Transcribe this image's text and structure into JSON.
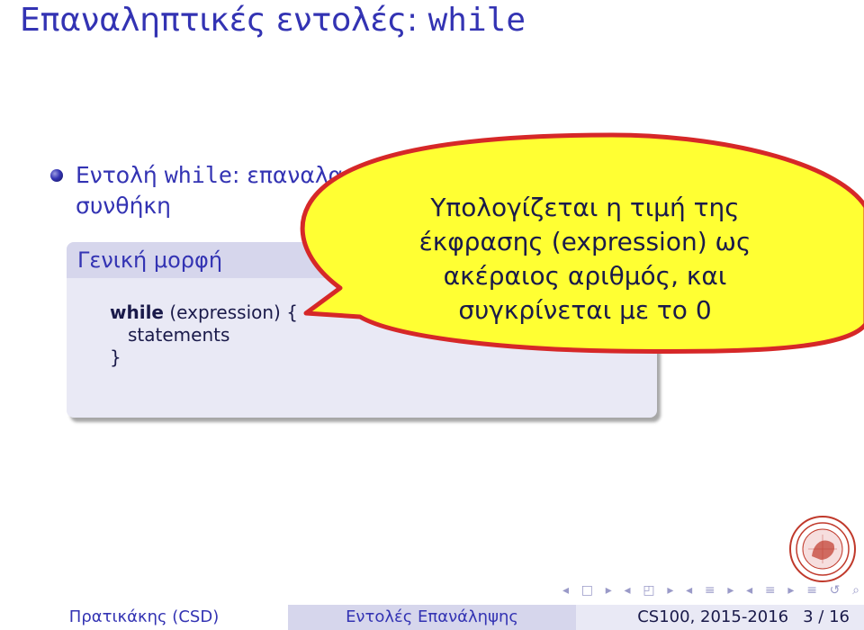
{
  "slide": {
    "title_prefix": "Επαναληπτικές εντολές: ",
    "title_keyword": "while",
    "bullet": {
      "prefix": "Εντολή ",
      "keyword": "while",
      "text": ": επαναλαμβάνει κάποιες εντολές για όσο ισχύει μια συνθήκη"
    },
    "block": {
      "title": "Γενική μορφή",
      "code_keyword": "while",
      "code_rest": " (expression) {",
      "code_body": "statements",
      "code_close": "}"
    },
    "callout_lines": [
      "Υπολογίζεται η τιμή της",
      "έκφρασης (expression) ως",
      "ακέραιος αριθμός, και",
      "συγκρίνεται με το 0"
    ]
  },
  "footer": {
    "author": "Πρατικάκης (CSD)",
    "section": "Εντολές Επανάληψης",
    "course": "CS100, 2015-2016",
    "page": "3 / 16"
  },
  "colors": {
    "structure": "#3333b3",
    "callout_fill": "#ffff33",
    "callout_stroke": "#d62828"
  }
}
